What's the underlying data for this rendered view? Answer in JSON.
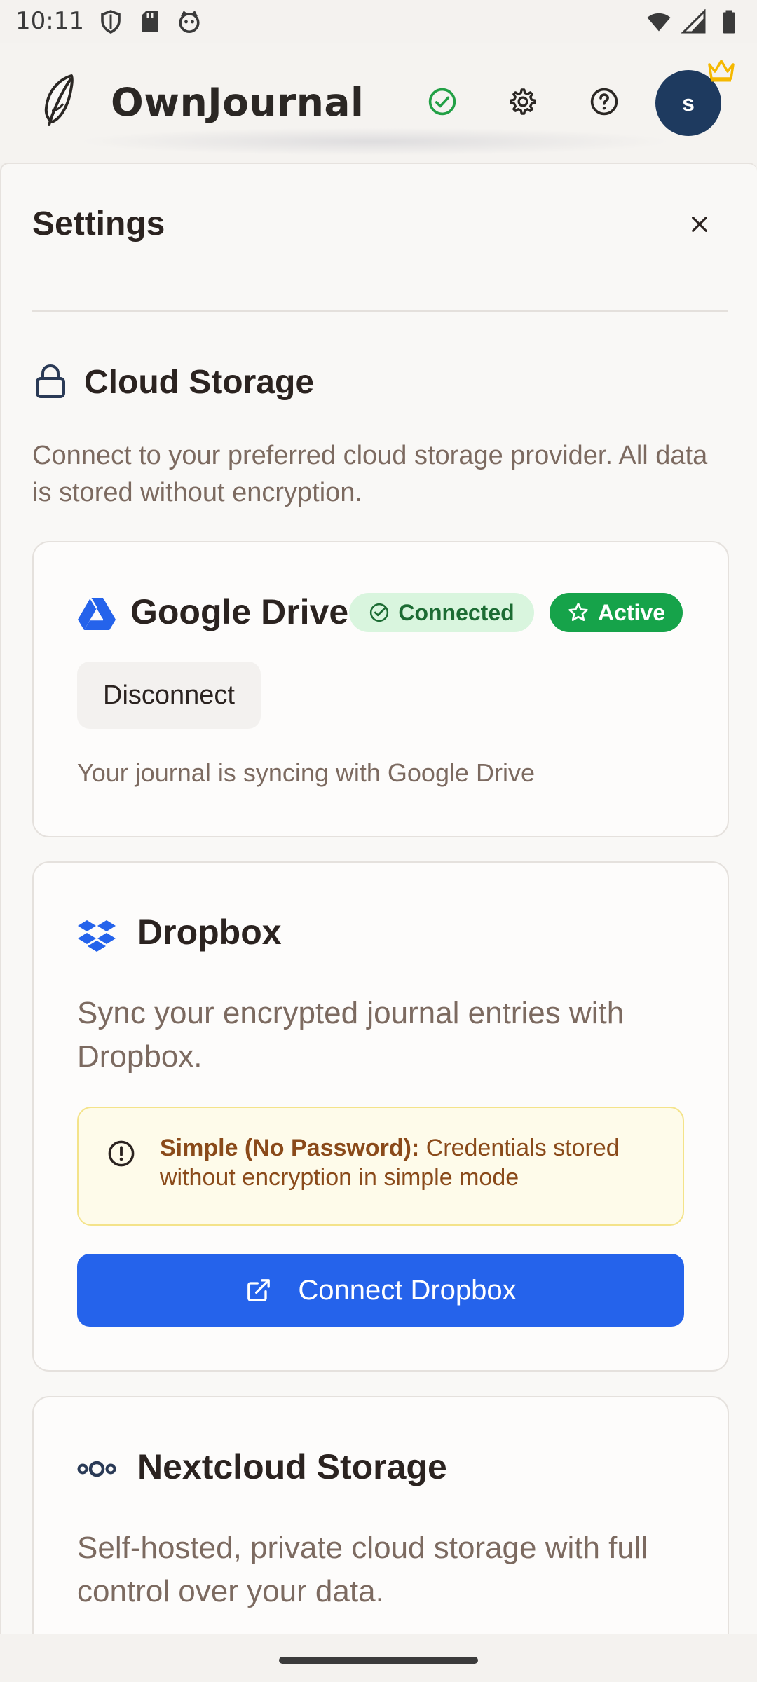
{
  "status_bar": {
    "time": "10:11",
    "left_icons": [
      "shield-icon",
      "sd-card-icon",
      "cat-face-icon"
    ],
    "right_icons": [
      "wifi-icon",
      "cell-signal-icon",
      "battery-icon"
    ]
  },
  "header": {
    "app_name": "OwnJournal",
    "avatar_initial": "s",
    "icons": [
      "feather-logo-icon",
      "sync-check-icon",
      "gear-icon",
      "help-icon",
      "crown-icon"
    ]
  },
  "settings": {
    "title": "Settings",
    "section": {
      "title": "Cloud Storage",
      "description": "Connect to your preferred cloud storage provider. All data is stored without encryption."
    },
    "google_drive": {
      "name": "Google Drive",
      "badge_connected": "Connected",
      "badge_active": "Active",
      "disconnect_label": "Disconnect",
      "status_text": "Your journal is syncing with Google Drive"
    },
    "dropbox": {
      "name": "Dropbox",
      "description": "Sync your encrypted journal entries with Dropbox.",
      "warning_bold": "Simple (No Password):",
      "warning_text": " Credentials stored without encryption in simple mode",
      "connect_label": "Connect Dropbox"
    },
    "nextcloud": {
      "name": "Nextcloud Storage",
      "description": "Self-hosted, private cloud storage with full control over your data."
    }
  },
  "colors": {
    "primary_blue": "#2563eb",
    "success_green": "#16a34a",
    "connected_bg": "#d9f5de",
    "avatar_bg": "#1e3a5f",
    "crown": "#f5b800",
    "warning_bg": "#fefbea"
  }
}
